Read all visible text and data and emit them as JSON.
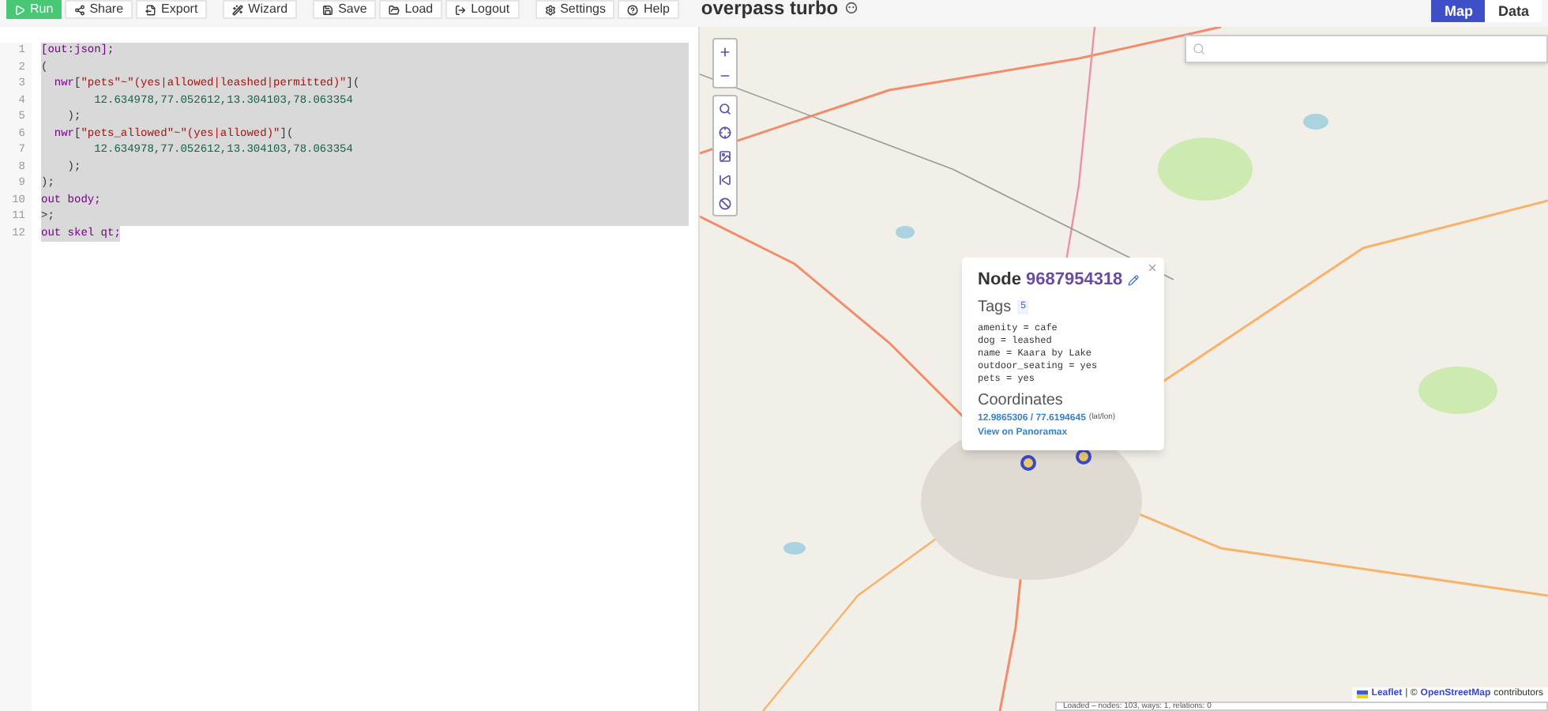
{
  "toolbar": {
    "buttons": [
      {
        "label": "Run",
        "kind": "primary"
      },
      {
        "label": "Share",
        "kind": "plain"
      },
      {
        "label": "Export",
        "kind": "plain"
      },
      {
        "label": "Wizard",
        "kind": "plain"
      },
      {
        "label": "Save",
        "kind": "plain"
      },
      {
        "label": "Load",
        "kind": "plain"
      },
      {
        "label": "Logout",
        "kind": "plain"
      },
      {
        "label": "Settings",
        "kind": "plain"
      },
      {
        "label": "Help",
        "kind": "plain"
      }
    ],
    "title": "overpass turbo",
    "tabs": [
      {
        "label": "Map",
        "selected": true
      },
      {
        "label": "Data",
        "selected": false
      }
    ]
  },
  "editor": {
    "lines": [
      {
        "number": "1",
        "selected": true,
        "tokens": [
          {
            "text": "[out:json];",
            "kind": "keyword"
          }
        ]
      },
      {
        "number": "2",
        "selected": true,
        "tokens": [
          {
            "text": "(",
            "kind": "punct"
          }
        ]
      },
      {
        "number": "3",
        "selected": true,
        "tokens": [
          {
            "text": "  nwr",
            "kind": "keyword"
          },
          {
            "text": "[",
            "kind": "punct"
          },
          {
            "text": "\"pets\"~\"(yes|allowed|leashed|permitted)\"",
            "kind": "string"
          },
          {
            "text": "](",
            "kind": "punct"
          }
        ]
      },
      {
        "number": "4",
        "selected": true,
        "tokens": [
          {
            "text": "        12.634978,77.052612,13.304103,78.063354",
            "kind": "number"
          }
        ]
      },
      {
        "number": "5",
        "selected": true,
        "tokens": [
          {
            "text": "    );",
            "kind": "punct"
          }
        ]
      },
      {
        "number": "6",
        "selected": true,
        "tokens": [
          {
            "text": "  nwr",
            "kind": "keyword"
          },
          {
            "text": "[",
            "kind": "punct"
          },
          {
            "text": "\"pets_allowed\"~\"(yes|allowed)\"",
            "kind": "string"
          },
          {
            "text": "](",
            "kind": "punct"
          }
        ]
      },
      {
        "number": "7",
        "selected": true,
        "tokens": [
          {
            "text": "        12.634978,77.052612,13.304103,78.063354",
            "kind": "number"
          }
        ]
      },
      {
        "number": "8",
        "selected": true,
        "tokens": [
          {
            "text": "    );",
            "kind": "punct"
          }
        ]
      },
      {
        "number": "9",
        "selected": true,
        "tokens": [
          {
            "text": ");",
            "kind": "punct"
          }
        ]
      },
      {
        "number": "10",
        "selected": true,
        "tokens": [
          {
            "text": "out body;",
            "kind": "keyword"
          }
        ]
      },
      {
        "number": "11",
        "selected": true,
        "tokens": [
          {
            "text": ">;",
            "kind": "punct"
          }
        ]
      },
      {
        "number": "12",
        "selected": true,
        "tokens": [
          {
            "text": "out skel qt;",
            "kind": "keyword"
          }
        ]
      }
    ]
  },
  "map": {
    "popup": {
      "heading": "Node",
      "id": "9687954318",
      "tags_label": "Tags",
      "tags_count": "5",
      "tags": [
        "amenity = cafe",
        "dog = leashed",
        "name = Kaara by Lake",
        "outdoor_seating = yes",
        "pets = yes"
      ],
      "coords_label": "Coordinates",
      "coords": "12.9865306 / 77.6194645",
      "coords_unit": "(lat/lon)",
      "link": "View on Panoramax"
    },
    "attribution": {
      "leaflet": "Leaflet",
      "separator": "| ©",
      "osm": "OpenStreetMap",
      "suffix": "contributors"
    },
    "status": "Loaded – nodes: 103, ways: 1, relations: 0"
  }
}
